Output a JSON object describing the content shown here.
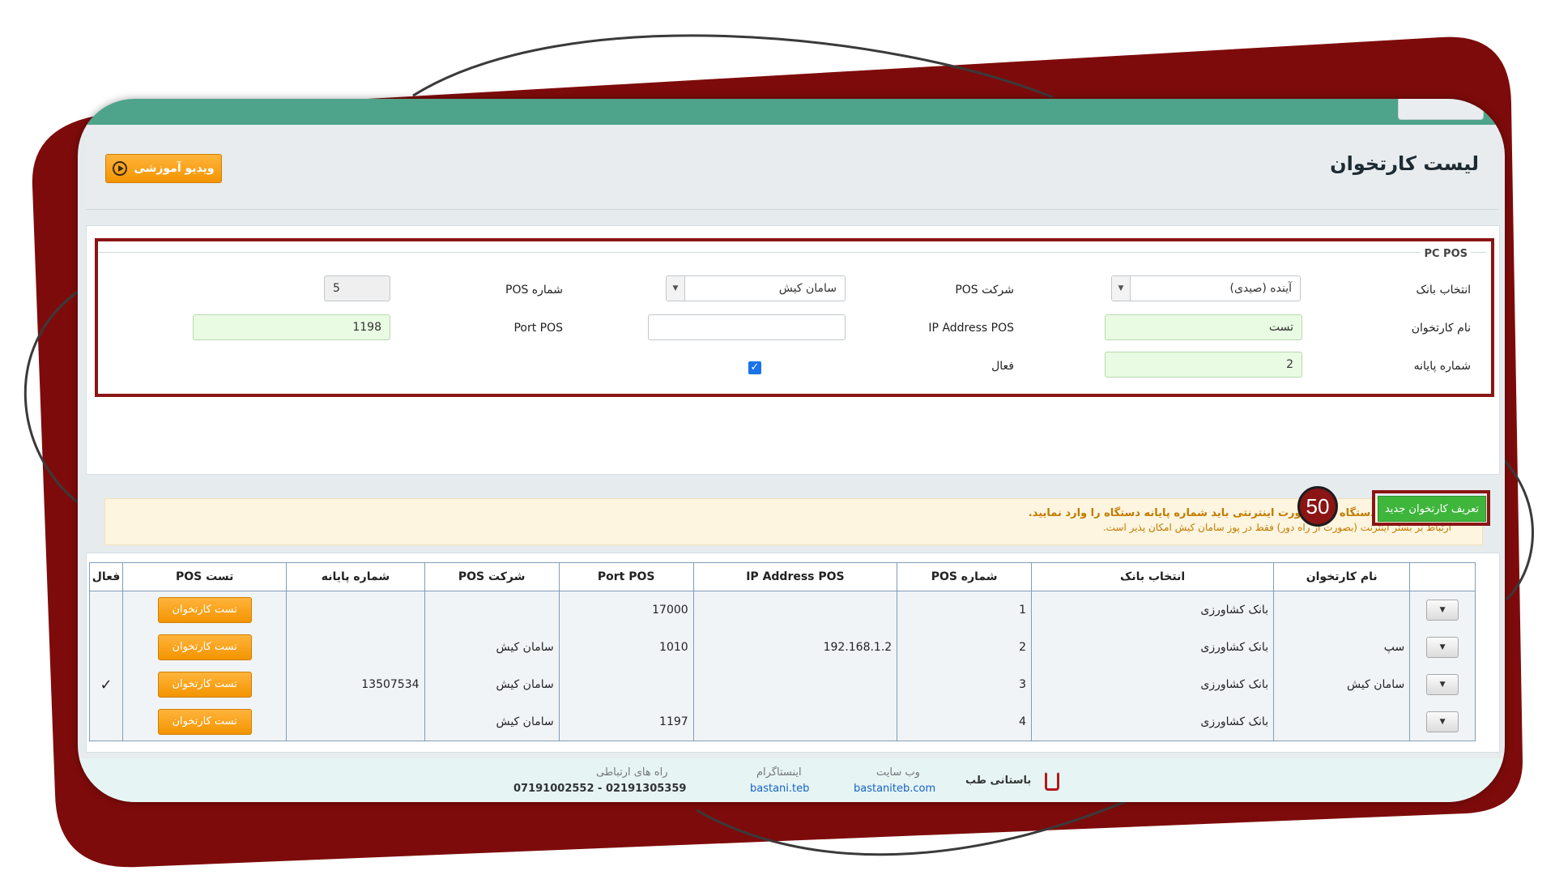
{
  "page": {
    "title": "لیست کارتخوان",
    "video_button": "ویدیو آموزشی"
  },
  "form": {
    "legend": "PC POS",
    "bank_label": "انتخاب بانک",
    "bank_value": "آینده (صیدی)",
    "company_label": "شرکت POS",
    "company_value": "سامان کیش",
    "posnum_label": "شماره POS",
    "posnum_value": "5",
    "name_label": "نام کارتخوان",
    "name_value": "تست",
    "ip_label": "IP Address POS",
    "ip_value": "",
    "port_label": "Port POS",
    "port_value": "1198",
    "terminal_label": "شماره پایانه",
    "terminal_value": "2",
    "active_label": "فعال",
    "active_checked": true,
    "notice_line1": "برای ارتباط با دستگاه پوز بصورت اینترنتی باید شماره پایانه دستگاه را وارد نمایید.",
    "notice_line2": "ارتباط بر بستر اینترنت (بصورت از راه دور) فقط در پوز سامان کیش امکان پذیر است."
  },
  "actions": {
    "new_button": "تعریف کارتخوان جدید",
    "step_badge": "50"
  },
  "table": {
    "headers": [
      "",
      "نام کارتخوان",
      "انتخاب بانک",
      "شماره POS",
      "IP Address POS",
      "Port POS",
      "شرکت POS",
      "شماره پایانه",
      "تست POS",
      "فعال"
    ],
    "test_label": "تست کارتخوان",
    "rows": [
      {
        "name": "",
        "bank": "بانک کشاورزی",
        "posnum": "1",
        "ip": "",
        "port": "17000",
        "company": "",
        "terminal": "",
        "active": ""
      },
      {
        "name": "سپ",
        "bank": "بانک کشاورزی",
        "posnum": "2",
        "ip": "192.168.1.2",
        "port": "1010",
        "company": "سامان کیش",
        "terminal": "",
        "active": ""
      },
      {
        "name": "سامان کیش",
        "bank": "بانک کشاورزی",
        "posnum": "3",
        "ip": "",
        "port": "",
        "company": "سامان کیش",
        "terminal": "13507534",
        "active": "✓"
      },
      {
        "name": "",
        "bank": "بانک کشاورزی",
        "posnum": "4",
        "ip": "",
        "port": "1197",
        "company": "سامان کیش",
        "terminal": "",
        "active": ""
      }
    ]
  },
  "footer": {
    "brand": "باستانی طب",
    "website_caption": "وب سایت",
    "website": "bastaniteb.com",
    "instagram_caption": "اینستاگرام",
    "instagram": "bastani.teb",
    "contact_caption": "راه های ارتباطی",
    "phones": "07191002552 - 02191305359"
  }
}
